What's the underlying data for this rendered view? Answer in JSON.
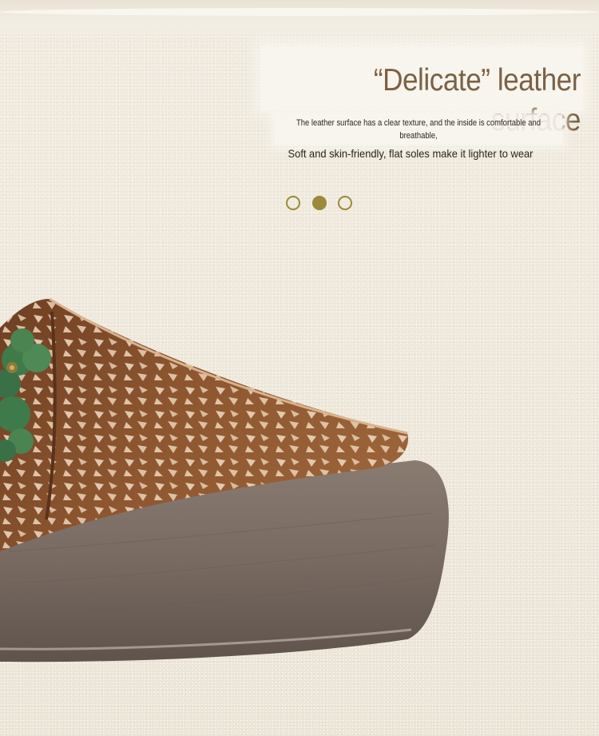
{
  "heading": {
    "title": "“Delicate” leather surface",
    "description": "The leather surface has a clear texture, and the inside is comfortable and breathable,",
    "subtitle": "Soft and skin-friendly, flat soles make it lighter to wear"
  },
  "carousel": {
    "dots": 3,
    "active_index": 1,
    "accent_color": "#9a8a3a"
  },
  "colors": {
    "background": "#efe9dc",
    "title_text": "#7b6146",
    "leather": "#8a5330",
    "sole": "#7a6b62",
    "flower": "#3f7a4a"
  },
  "image": {
    "subject": "brown leather wedge slipper with cut-out pattern and green flowers"
  }
}
